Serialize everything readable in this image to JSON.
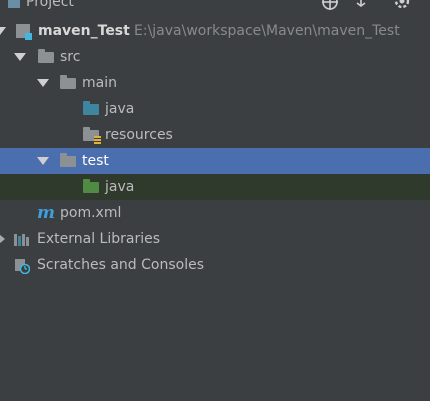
{
  "header": {
    "title": "Project"
  },
  "tree": {
    "module": {
      "name": "maven_Test",
      "path": "E:\\java\\workspace\\Maven\\maven_Test"
    },
    "src": "src",
    "main": "main",
    "main_java": "java",
    "resources": "resources",
    "test": "test",
    "test_java": "java",
    "pom": "pom.xml",
    "external_libraries": "External Libraries",
    "scratches": "Scratches and Consoles"
  },
  "colors": {
    "background": "#3c3f41",
    "selection": "#4b6eaf",
    "source_folder": "#3e86a0",
    "test_folder": "#4f8b42",
    "maven_icon": "#3f9fdd"
  }
}
